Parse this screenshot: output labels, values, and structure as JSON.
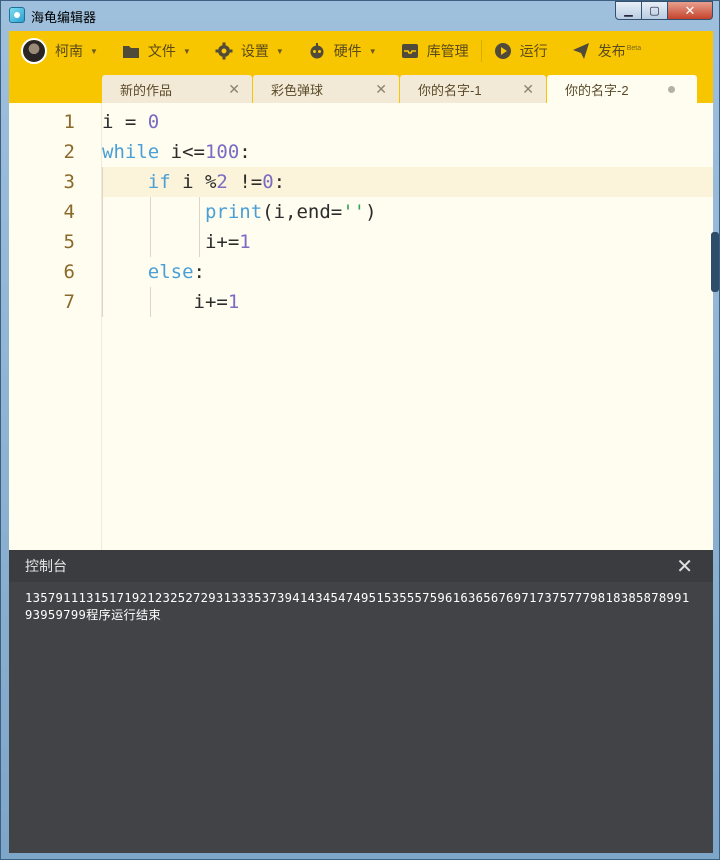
{
  "window": {
    "title": "海龟编辑器"
  },
  "toolbar": {
    "user": "柯南",
    "file": "文件",
    "settings": "设置",
    "hardware": "硬件",
    "library": "库管理",
    "run": "运行",
    "publish": "发布",
    "publish_badge": "Beta",
    "icons": [
      "avatar",
      "folder-icon",
      "gear-icon",
      "hardware-icon",
      "inbox-icon",
      "play-circle-icon",
      "send-icon"
    ]
  },
  "tabs": [
    {
      "label": "新的作品",
      "active": false
    },
    {
      "label": "彩色弹球",
      "active": false
    },
    {
      "label": "你的名字-1",
      "active": false
    },
    {
      "label": "你的名字-2",
      "active": true
    }
  ],
  "editor": {
    "line_numbers": [
      "1",
      "2",
      "3",
      "4",
      "5",
      "6",
      "7"
    ],
    "highlight_line": 3,
    "lines": [
      "i = 0",
      "while i<=100:",
      "    if i %2 !=0:",
      "         print(i,end='')",
      "         i+=1",
      "    else:",
      "        i+=1"
    ]
  },
  "run_button": {
    "label": "运行"
  },
  "console": {
    "title": "控制台",
    "output": "13579111315171921232527293133353739414345474951535557596163656769717375777981838587899193959799程序运行结束"
  },
  "colors": {
    "accent": "#f7c600",
    "keyword": "#4aa0d6",
    "number": "#7a6bc4",
    "string": "#3aa05a"
  }
}
